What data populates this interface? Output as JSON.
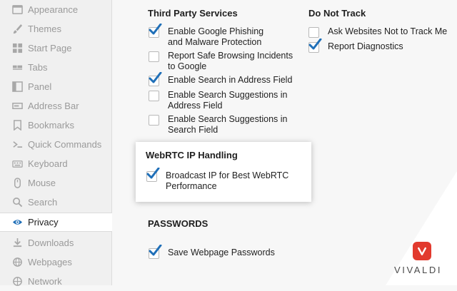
{
  "brand": {
    "name": "VIVALDI",
    "color": "#e23a2e"
  },
  "accent": "#1f6fb8",
  "sidebar": {
    "items": [
      {
        "label": "Appearance",
        "icon": "appearance-icon",
        "active": false
      },
      {
        "label": "Themes",
        "icon": "themes-icon",
        "active": false
      },
      {
        "label": "Start Page",
        "icon": "start-page-icon",
        "active": false
      },
      {
        "label": "Tabs",
        "icon": "tabs-icon",
        "active": false
      },
      {
        "label": "Panel",
        "icon": "panel-icon",
        "active": false
      },
      {
        "label": "Address Bar",
        "icon": "address-bar-icon",
        "active": false
      },
      {
        "label": "Bookmarks",
        "icon": "bookmark-icon",
        "active": false
      },
      {
        "label": "Quick Commands",
        "icon": "quick-commands-icon",
        "active": false
      },
      {
        "label": "Keyboard",
        "icon": "keyboard-icon",
        "active": false
      },
      {
        "label": "Mouse",
        "icon": "mouse-icon",
        "active": false
      },
      {
        "label": "Search",
        "icon": "search-icon",
        "active": false
      },
      {
        "label": "Privacy",
        "icon": "eye-icon",
        "active": true
      },
      {
        "label": "Downloads",
        "icon": "download-icon",
        "active": false
      },
      {
        "label": "Webpages",
        "icon": "webpages-icon",
        "active": false
      },
      {
        "label": "Network",
        "icon": "network-icon",
        "active": false
      }
    ]
  },
  "third_party": {
    "title": "Third Party Services",
    "options": [
      {
        "label": "Enable Google Phishing and Malware Protection",
        "checked": true
      },
      {
        "label": "Report Safe Browsing Incidents to Google",
        "checked": false
      },
      {
        "label": "Enable Search in Address Field",
        "checked": true
      },
      {
        "label": "Enable Search Suggestions in Address Field",
        "checked": false
      },
      {
        "label": "Enable Search Suggestions in Search Field",
        "checked": false
      }
    ]
  },
  "do_not_track": {
    "title": "Do Not Track",
    "options": [
      {
        "label": "Ask Websites Not to Track Me",
        "checked": false
      },
      {
        "label": "Report Diagnostics",
        "checked": true
      }
    ]
  },
  "webrtc": {
    "title": "WebRTC IP Handling",
    "options": [
      {
        "label": "Broadcast IP for Best WebRTC Performance",
        "checked": true
      }
    ]
  },
  "passwords": {
    "title": "PASSWORDS",
    "options": [
      {
        "label": "Save Webpage Passwords",
        "checked": true
      }
    ]
  }
}
